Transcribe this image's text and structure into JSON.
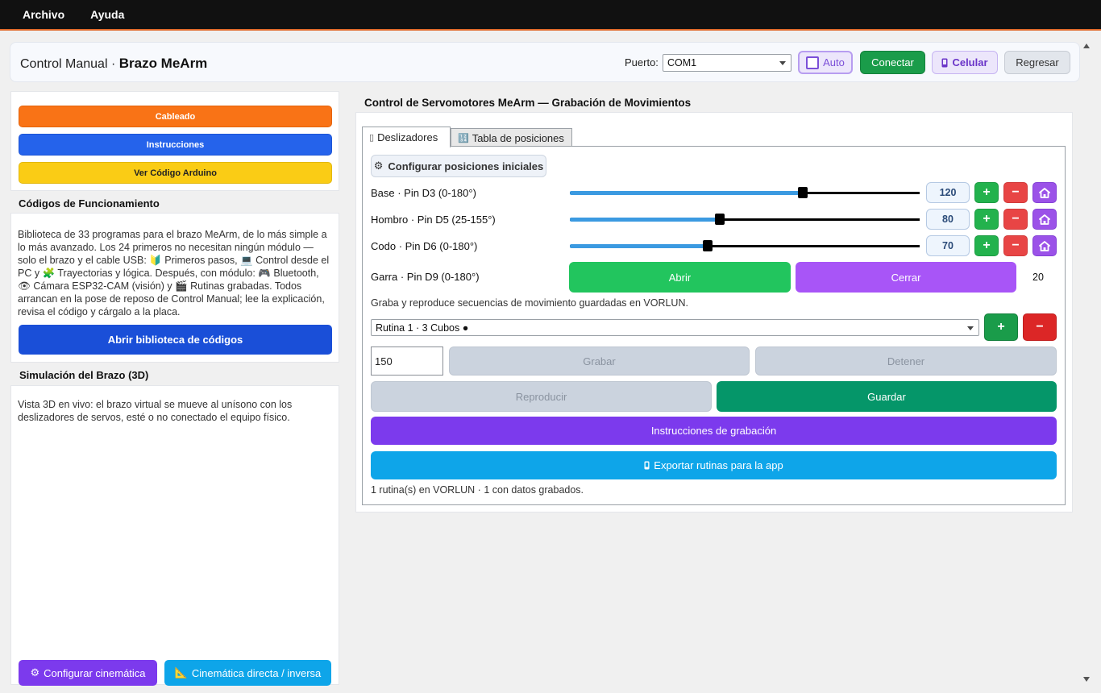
{
  "menu": {
    "items": [
      "Archivo",
      "Ayuda"
    ]
  },
  "header": {
    "title_prefix": "Control Manual · ",
    "title_bold": "Brazo MeArm",
    "port_label": "Puerto:",
    "port_value": "COM1",
    "auto_label": "Auto",
    "connect_label": "Conectar",
    "celular_label": "Celular",
    "regresar_label": "Regresar"
  },
  "left": {
    "buttons": {
      "cableado": "Cableado",
      "instrucciones": "Instrucciones",
      "arduino": "Ver Código Arduino"
    },
    "codes_title": "Códigos de Funcionamiento",
    "codes_text": "Biblioteca de 33 programas para el brazo MeArm, de lo más simple a lo más avanzado. Los 24 primeros no necesitan ningún módulo — solo el brazo y el cable USB: 🔰 Primeros pasos, 💻 Control desde el PC y 🧩 Trayectorias y lógica. Después, con módulo: 🎮 Bluetooth, 👁 Cámara ESP32-CAM (visión) y 🎬 Rutinas grabadas. Todos arrancan en la pose de reposo de Control Manual; lee la explicación, revisa el código y cárgalo a la placa.",
    "library_button": "Abrir biblioteca de códigos",
    "sim_title": "Simulación del Brazo (3D)",
    "sim_text": "Vista 3D en vivo: el brazo virtual se mueve al unísono con los deslizadores de servos, esté o no conectado el equipo físico.",
    "config_kinematics": "Configurar cinemática",
    "kinematics": "Cinemática directa / inversa"
  },
  "right": {
    "title": "Control de Servomotores MeArm — Grabación de Movimientos",
    "tabs": [
      "Deslizadores",
      "Tabla de posiciones"
    ],
    "config_initial": "Configurar posiciones iniciales",
    "servos": [
      {
        "label": "Base · Pin D3 (0-180°)",
        "value": "120",
        "fraction": 0.667
      },
      {
        "label": "Hombro · Pin D5 (25-155°)",
        "value": "80",
        "fraction": 0.428
      },
      {
        "label": "Codo · Pin D6 (0-180°)",
        "value": "70",
        "fraction": 0.394
      }
    ],
    "gripper": {
      "label": "Garra · Pin D9 (0-180°)",
      "open": "Abrir",
      "close": "Cerrar",
      "value": "20"
    },
    "record_info": "Graba y reproduce secuencias de movimiento guardadas en VORLUN.",
    "routine_selected": "Rutina 1 · 3 Cubos ●",
    "interval_value": "150",
    "grabar": "Grabar",
    "detener": "Detener",
    "reproducir": "Reproducir",
    "guardar": "Guardar",
    "rec_instructions": "Instrucciones de grabación",
    "export": "Exportar rutinas para la app",
    "status": "1 rutina(s) en VORLUN · 1 con datos grabados."
  },
  "colors": {
    "orange": "#f97316",
    "blue": "#2563eb",
    "yellow": "#facc15",
    "green": "#22c55e",
    "purple": "#a855f7",
    "teal": "#059669",
    "violet": "#7c3aed",
    "sky": "#0ea5e9"
  },
  "icons": {
    "plus": "+",
    "minus": "−",
    "home": "house-icon",
    "gear": "⚙",
    "ruler": "📐",
    "phone": "📱",
    "tab1": "▯",
    "tab2": "🔢"
  }
}
